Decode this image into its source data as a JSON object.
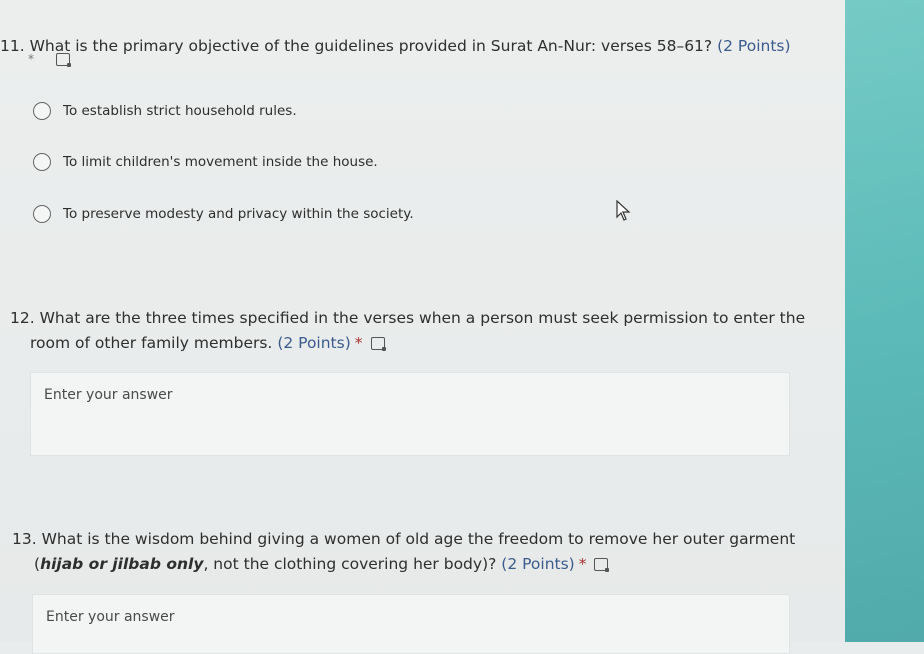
{
  "q11": {
    "number": "11.",
    "text": "What is the primary objective of the guidelines provided in Surat An-Nur: verses 58–61?",
    "points": "(2 Points)",
    "required_mark": "*",
    "options": [
      {
        "label": "To establish strict household rules."
      },
      {
        "label": "To limit children's movement inside the house."
      },
      {
        "label": "To preserve modesty and privacy within the society."
      }
    ]
  },
  "q12": {
    "number": "12.",
    "text_line1": "What are the three times specified in the verses when a person must seek permission to enter the",
    "text_line2": "room of other family members.",
    "points": "(2 Points)",
    "required_mark": "*",
    "answer_placeholder": "Enter your answer"
  },
  "q13": {
    "number": "13.",
    "text_line1": "What is the wisdom behind giving a women of old age the freedom to remove her outer garment",
    "open_paren": "(",
    "emphasis": "hijab or jilbab only",
    "text_line2_rest": ", not the clothing covering her body)?",
    "points": "(2 Points)",
    "required_mark": "*",
    "answer_placeholder": "Enter your answer"
  },
  "colors": {
    "background": "#e9ecec",
    "side_panel": "#5ab9b7",
    "points_text": "#3b5b8c",
    "required": "#aa3333"
  },
  "icons": [
    "immersive-reader-icon",
    "mouse-pointer-icon"
  ]
}
